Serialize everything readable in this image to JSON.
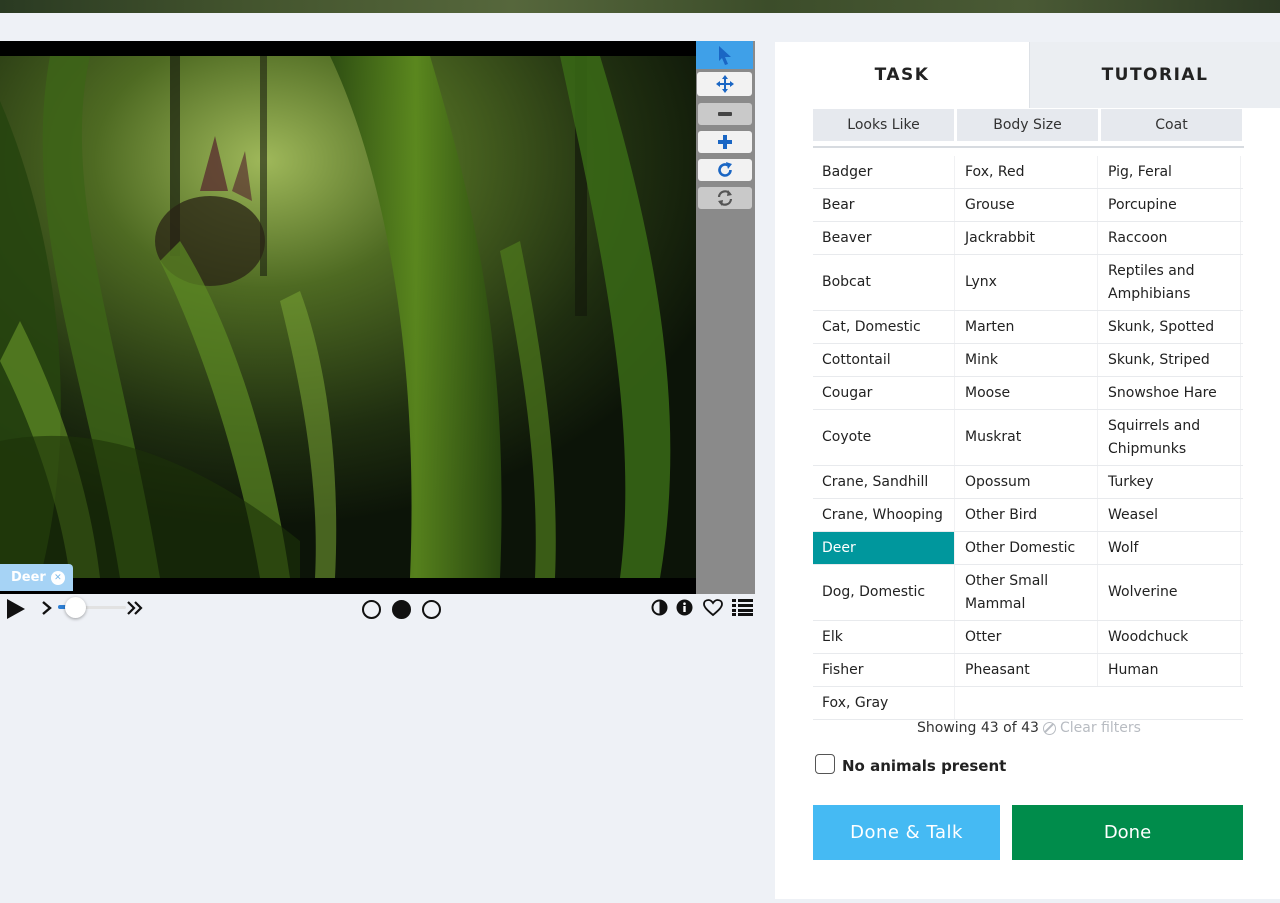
{
  "viewer": {
    "mark_label": "Deer",
    "tools": [
      {
        "name": "annotate-icon",
        "active": true
      },
      {
        "name": "move-icon"
      },
      {
        "name": "zoom-out-icon"
      },
      {
        "name": "zoom-in-icon"
      },
      {
        "name": "rotate-icon"
      },
      {
        "name": "reset-icon"
      }
    ]
  },
  "controls": {
    "playback_progress": 0.2,
    "frames": 3,
    "current_frame": 2,
    "icons": [
      "play-icon",
      "step-forward-icon",
      "fast-forward-icon",
      "invert-icon",
      "info-icon",
      "heart-icon",
      "collections-icon"
    ]
  },
  "tabs": {
    "task": "TASK",
    "tutorial": "TUTORIAL"
  },
  "filters": {
    "looks_like": "Looks Like",
    "body_size": "Body Size",
    "coat": "Coat"
  },
  "choices": [
    [
      "Badger",
      "Fox, Red",
      "Pig, Feral"
    ],
    [
      "Bear",
      "Grouse",
      "Porcupine"
    ],
    [
      "Beaver",
      "Jackrabbit",
      "Raccoon"
    ],
    [
      "Bobcat",
      "Lynx",
      "Reptiles and Amphibians"
    ],
    [
      "Cat, Domestic",
      "Marten",
      "Skunk, Spotted"
    ],
    [
      "Cottontail",
      "Mink",
      "Skunk, Striped"
    ],
    [
      "Cougar",
      "Moose",
      "Snowshoe Hare"
    ],
    [
      "Coyote",
      "Muskrat",
      "Squirrels and Chipmunks"
    ],
    [
      "Crane, Sandhill",
      "Opossum",
      "Turkey"
    ],
    [
      "Crane, Whooping",
      "Other Bird",
      "Weasel"
    ],
    [
      "Deer",
      "Other Domestic",
      "Wolf"
    ],
    [
      "Dog, Domestic",
      "Other Small Mammal",
      "Wolverine"
    ],
    [
      "Elk",
      "Otter",
      "Woodchuck"
    ],
    [
      "Fisher",
      "Pheasant",
      "Human"
    ],
    [
      "Fox, Gray"
    ]
  ],
  "selected_choice": "Deer",
  "footer": {
    "showing": "Showing 43 of 43",
    "clear_filters": "Clear filters",
    "no_animals": "No animals present",
    "done_talk": "Done & Talk",
    "done": "Done"
  },
  "colors": {
    "selected": "#00979d",
    "done": "#008c4b",
    "done_talk": "#45baf3",
    "active_tool": "#3fa0e8"
  }
}
